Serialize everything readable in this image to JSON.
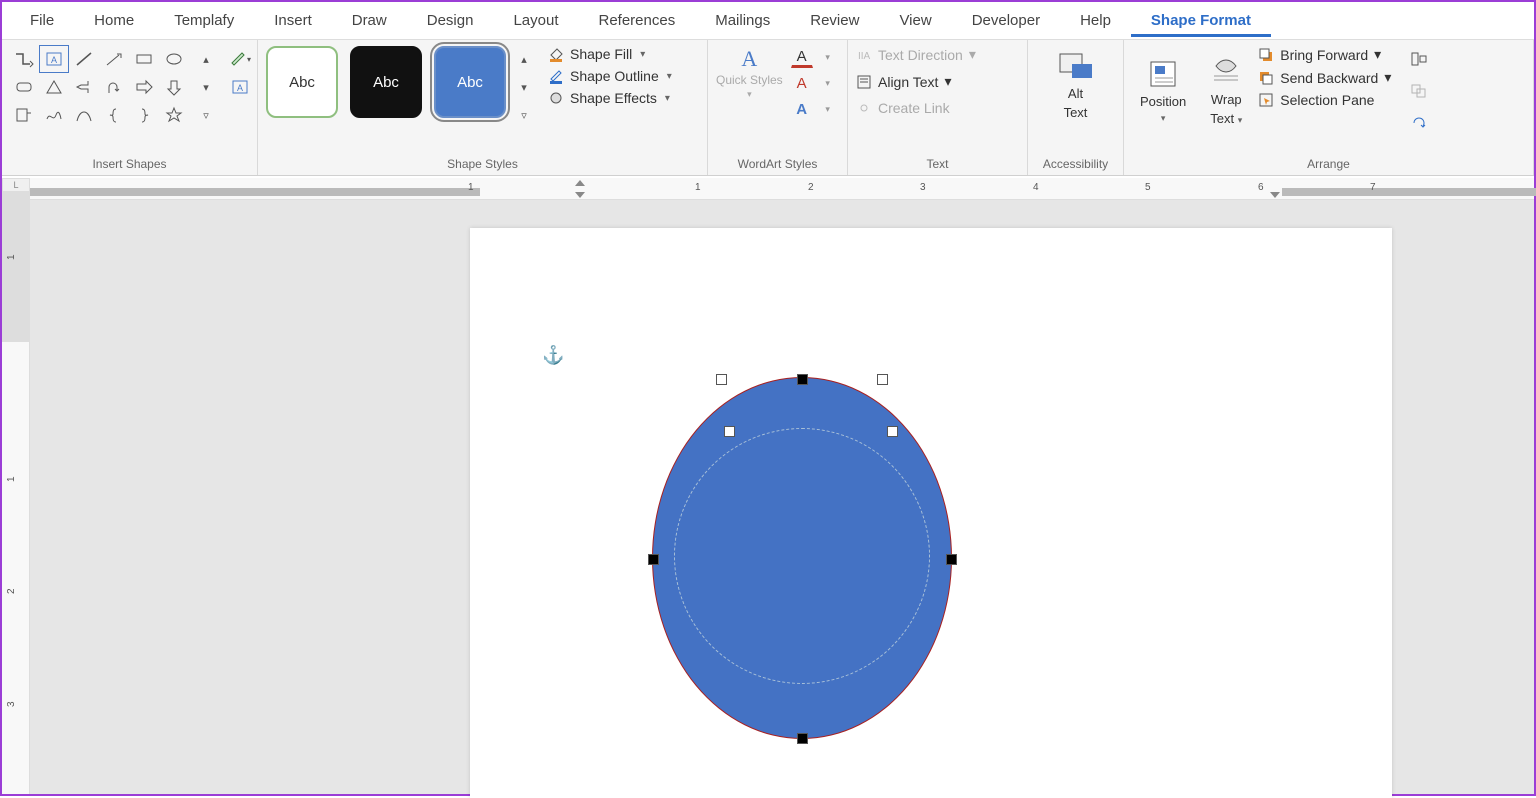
{
  "tabs": {
    "file": "File",
    "home": "Home",
    "templafy": "Templafy",
    "insert": "Insert",
    "draw": "Draw",
    "design": "Design",
    "layout": "Layout",
    "references": "References",
    "mailings": "Mailings",
    "review": "Review",
    "view": "View",
    "developer": "Developer",
    "help": "Help",
    "shape_format": "Shape Format"
  },
  "groups": {
    "insert_shapes": "Insert Shapes",
    "shape_styles": "Shape Styles",
    "wordart_styles": "WordArt Styles",
    "text": "Text",
    "accessibility": "Accessibility",
    "arrange": "Arrange"
  },
  "style_preview_label": "Abc",
  "shape_fill": "Shape Fill",
  "shape_outline": "Shape Outline",
  "shape_effects": "Shape Effects",
  "quick_styles": "Quick Styles",
  "text_direction": "Text Direction",
  "align_text": "Align Text",
  "create_link": "Create Link",
  "alt_text_line1": "Alt",
  "alt_text_line2": "Text",
  "position": "Position",
  "wrap_text_line1": "Wrap",
  "wrap_text_line2": "Text",
  "bring_forward": "Bring Forward",
  "send_backward": "Send Backward",
  "selection_pane": "Selection Pane",
  "ruler": {
    "h": [
      "1",
      "1",
      "2",
      "3",
      "4",
      "5",
      "6",
      "7"
    ],
    "v": [
      "1",
      "1",
      "2",
      "3"
    ]
  }
}
